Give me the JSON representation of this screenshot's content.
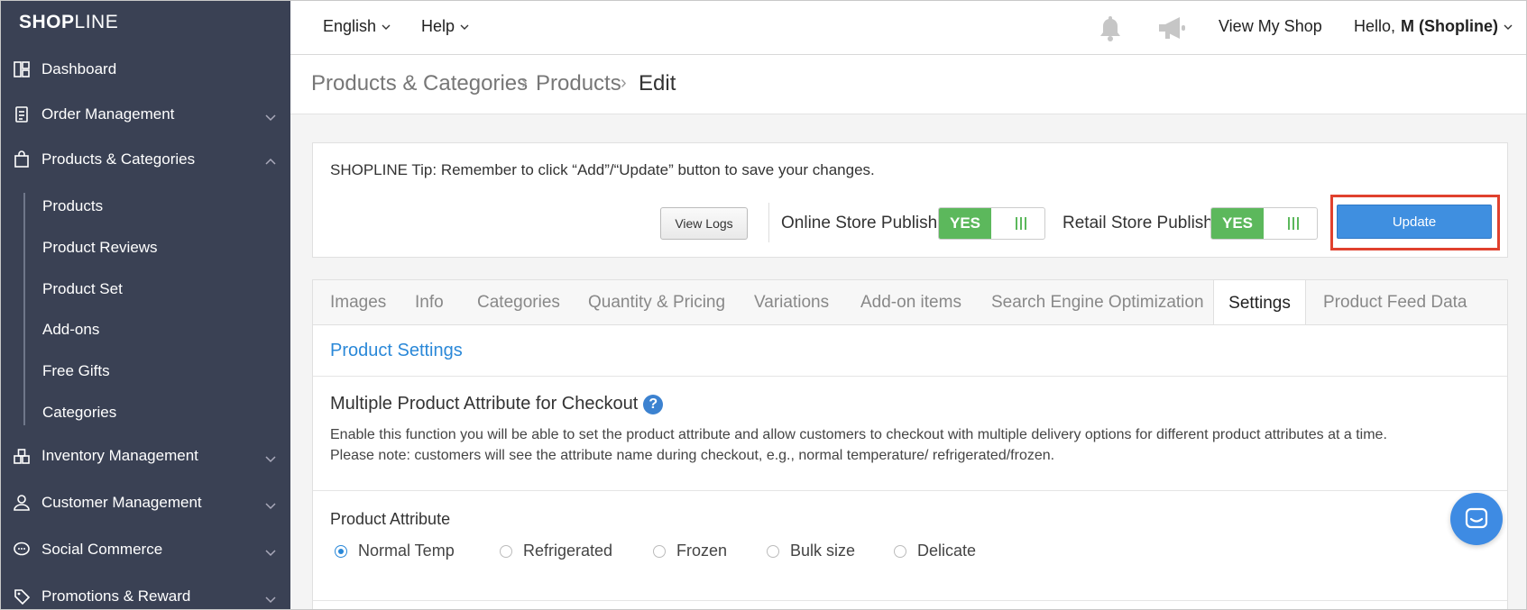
{
  "brand": {
    "logo_bold": "SHOP",
    "logo_thin": "LINE"
  },
  "sidebar": {
    "items": [
      {
        "label": "Dashboard",
        "icon": "dashboard-icon"
      },
      {
        "label": "Order Management",
        "icon": "clipboard-icon"
      },
      {
        "label": "Products & Categories",
        "icon": "bag-icon"
      },
      {
        "label": "Inventory Management",
        "icon": "warehouse-icon"
      },
      {
        "label": "Customer Management",
        "icon": "user-icon"
      },
      {
        "label": "Social Commerce",
        "icon": "chat-icon"
      },
      {
        "label": "Promotions & Reward",
        "icon": "tag-icon"
      }
    ],
    "subitems": [
      "Products",
      "Product Reviews",
      "Product Set",
      "Add-ons",
      "Free Gifts",
      "Categories"
    ]
  },
  "topbar": {
    "language": "English",
    "help": "Help",
    "view_shop": "View My Shop",
    "greeting": "Hello,",
    "user": "M (Shopline)"
  },
  "breadcrumb": [
    "Products & Categories",
    "Products",
    "Edit"
  ],
  "tip": {
    "text": "SHOPLINE Tip: Remember to click “Add”/“Update” button to save your changes.",
    "view_logs": "View Logs",
    "online_label": "Online Store Publish",
    "retail_label": "Retail Store Publish",
    "toggle_on": "YES",
    "update": "Update"
  },
  "tabs": [
    "Images",
    "Info",
    "Categories",
    "Quantity & Pricing",
    "Variations",
    "Add-on items",
    "Search Engine Optimization",
    "Settings",
    "Product Feed Data"
  ],
  "settings": {
    "section_title": "Product Settings",
    "attr_title": "Multiple Product Attribute for Checkout",
    "help_glyph": "?",
    "desc_line1": "Enable this function you will be able to set the product attribute and allow customers to checkout with multiple delivery options for different product attributes at a time.",
    "desc_line2": "Please note: customers will see the attribute name during checkout, e.g., normal temperature/ refrigerated/frozen.",
    "attribute_label": "Product Attribute",
    "options": [
      "Normal Temp",
      "Refrigerated",
      "Frozen",
      "Bulk size",
      "Delicate"
    ],
    "selected": "Normal Temp"
  },
  "colors": {
    "sidebar_bg": "#3a4154",
    "accent_blue": "#3f8fe0",
    "toggle_green": "#5cb85c",
    "highlight_red": "#e0412e"
  }
}
